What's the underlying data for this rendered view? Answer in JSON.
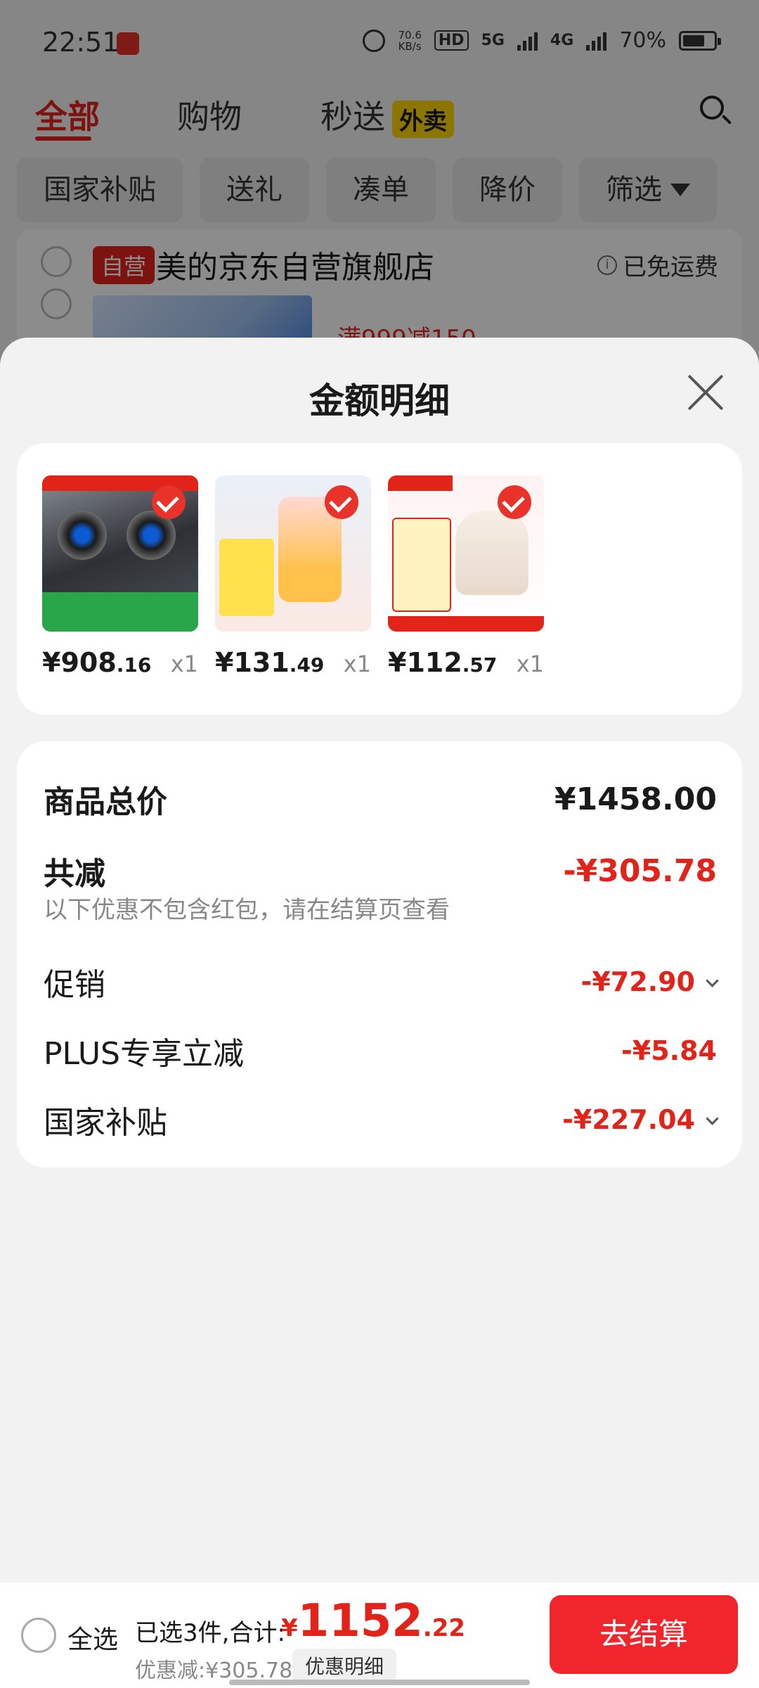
{
  "status_bar": {
    "time": "22:51",
    "net_speed": "70.6\nKB/s",
    "hd": "HD",
    "net_5g": "5G",
    "net_4g": "4G",
    "battery": "70%"
  },
  "top_tabs": [
    {
      "label": "全部",
      "active": true
    },
    {
      "label": "购物",
      "active": false
    },
    {
      "label": "秒送",
      "active": false,
      "badge": "外卖"
    }
  ],
  "filters": [
    "国家补贴",
    "送礼",
    "凑单",
    "降价",
    "筛选"
  ],
  "store": {
    "badge": "自营",
    "name": "美的京东自营旗舰店",
    "shipping": "已免运费"
  },
  "peek_promo": "满999减150",
  "sheet": {
    "title": "金额明细",
    "products": [
      {
        "price_int": "¥908",
        "price_dec": ".16",
        "qty": "x1",
        "icon": "gas-stove-image"
      },
      {
        "price_int": "¥131",
        "price_dec": ".49",
        "qty": "x1",
        "icon": "blender-image"
      },
      {
        "price_int": "¥112",
        "price_dec": ".57",
        "qty": "x1",
        "icon": "rice-cooker-image"
      }
    ],
    "summary": {
      "total_label": "商品总价",
      "total_value": "¥1458.00",
      "reduce_label": "共减",
      "reduce_value": "-¥305.78",
      "note": "以下优惠不包含红包，请在结算页查看",
      "promo_label": "促销",
      "promo_value": "-¥72.90",
      "plus_label": "PLUS专享立减",
      "plus_value": "-¥5.84",
      "subsidy_label": "国家补贴",
      "subsidy_value": "-¥227.04"
    }
  },
  "bottom_bar": {
    "select_all": "全选",
    "count_text": "已选3件,合计:",
    "total_currency": "¥",
    "total_int": "1152",
    "total_dec": ".22",
    "discount_text": "优惠减:¥305.78",
    "detail_label": "优惠明细",
    "checkout_label": "去结算"
  },
  "colors": {
    "accent": "#e2231a",
    "checkout": "#f0262c",
    "badge_yellow": "#ffd500"
  }
}
